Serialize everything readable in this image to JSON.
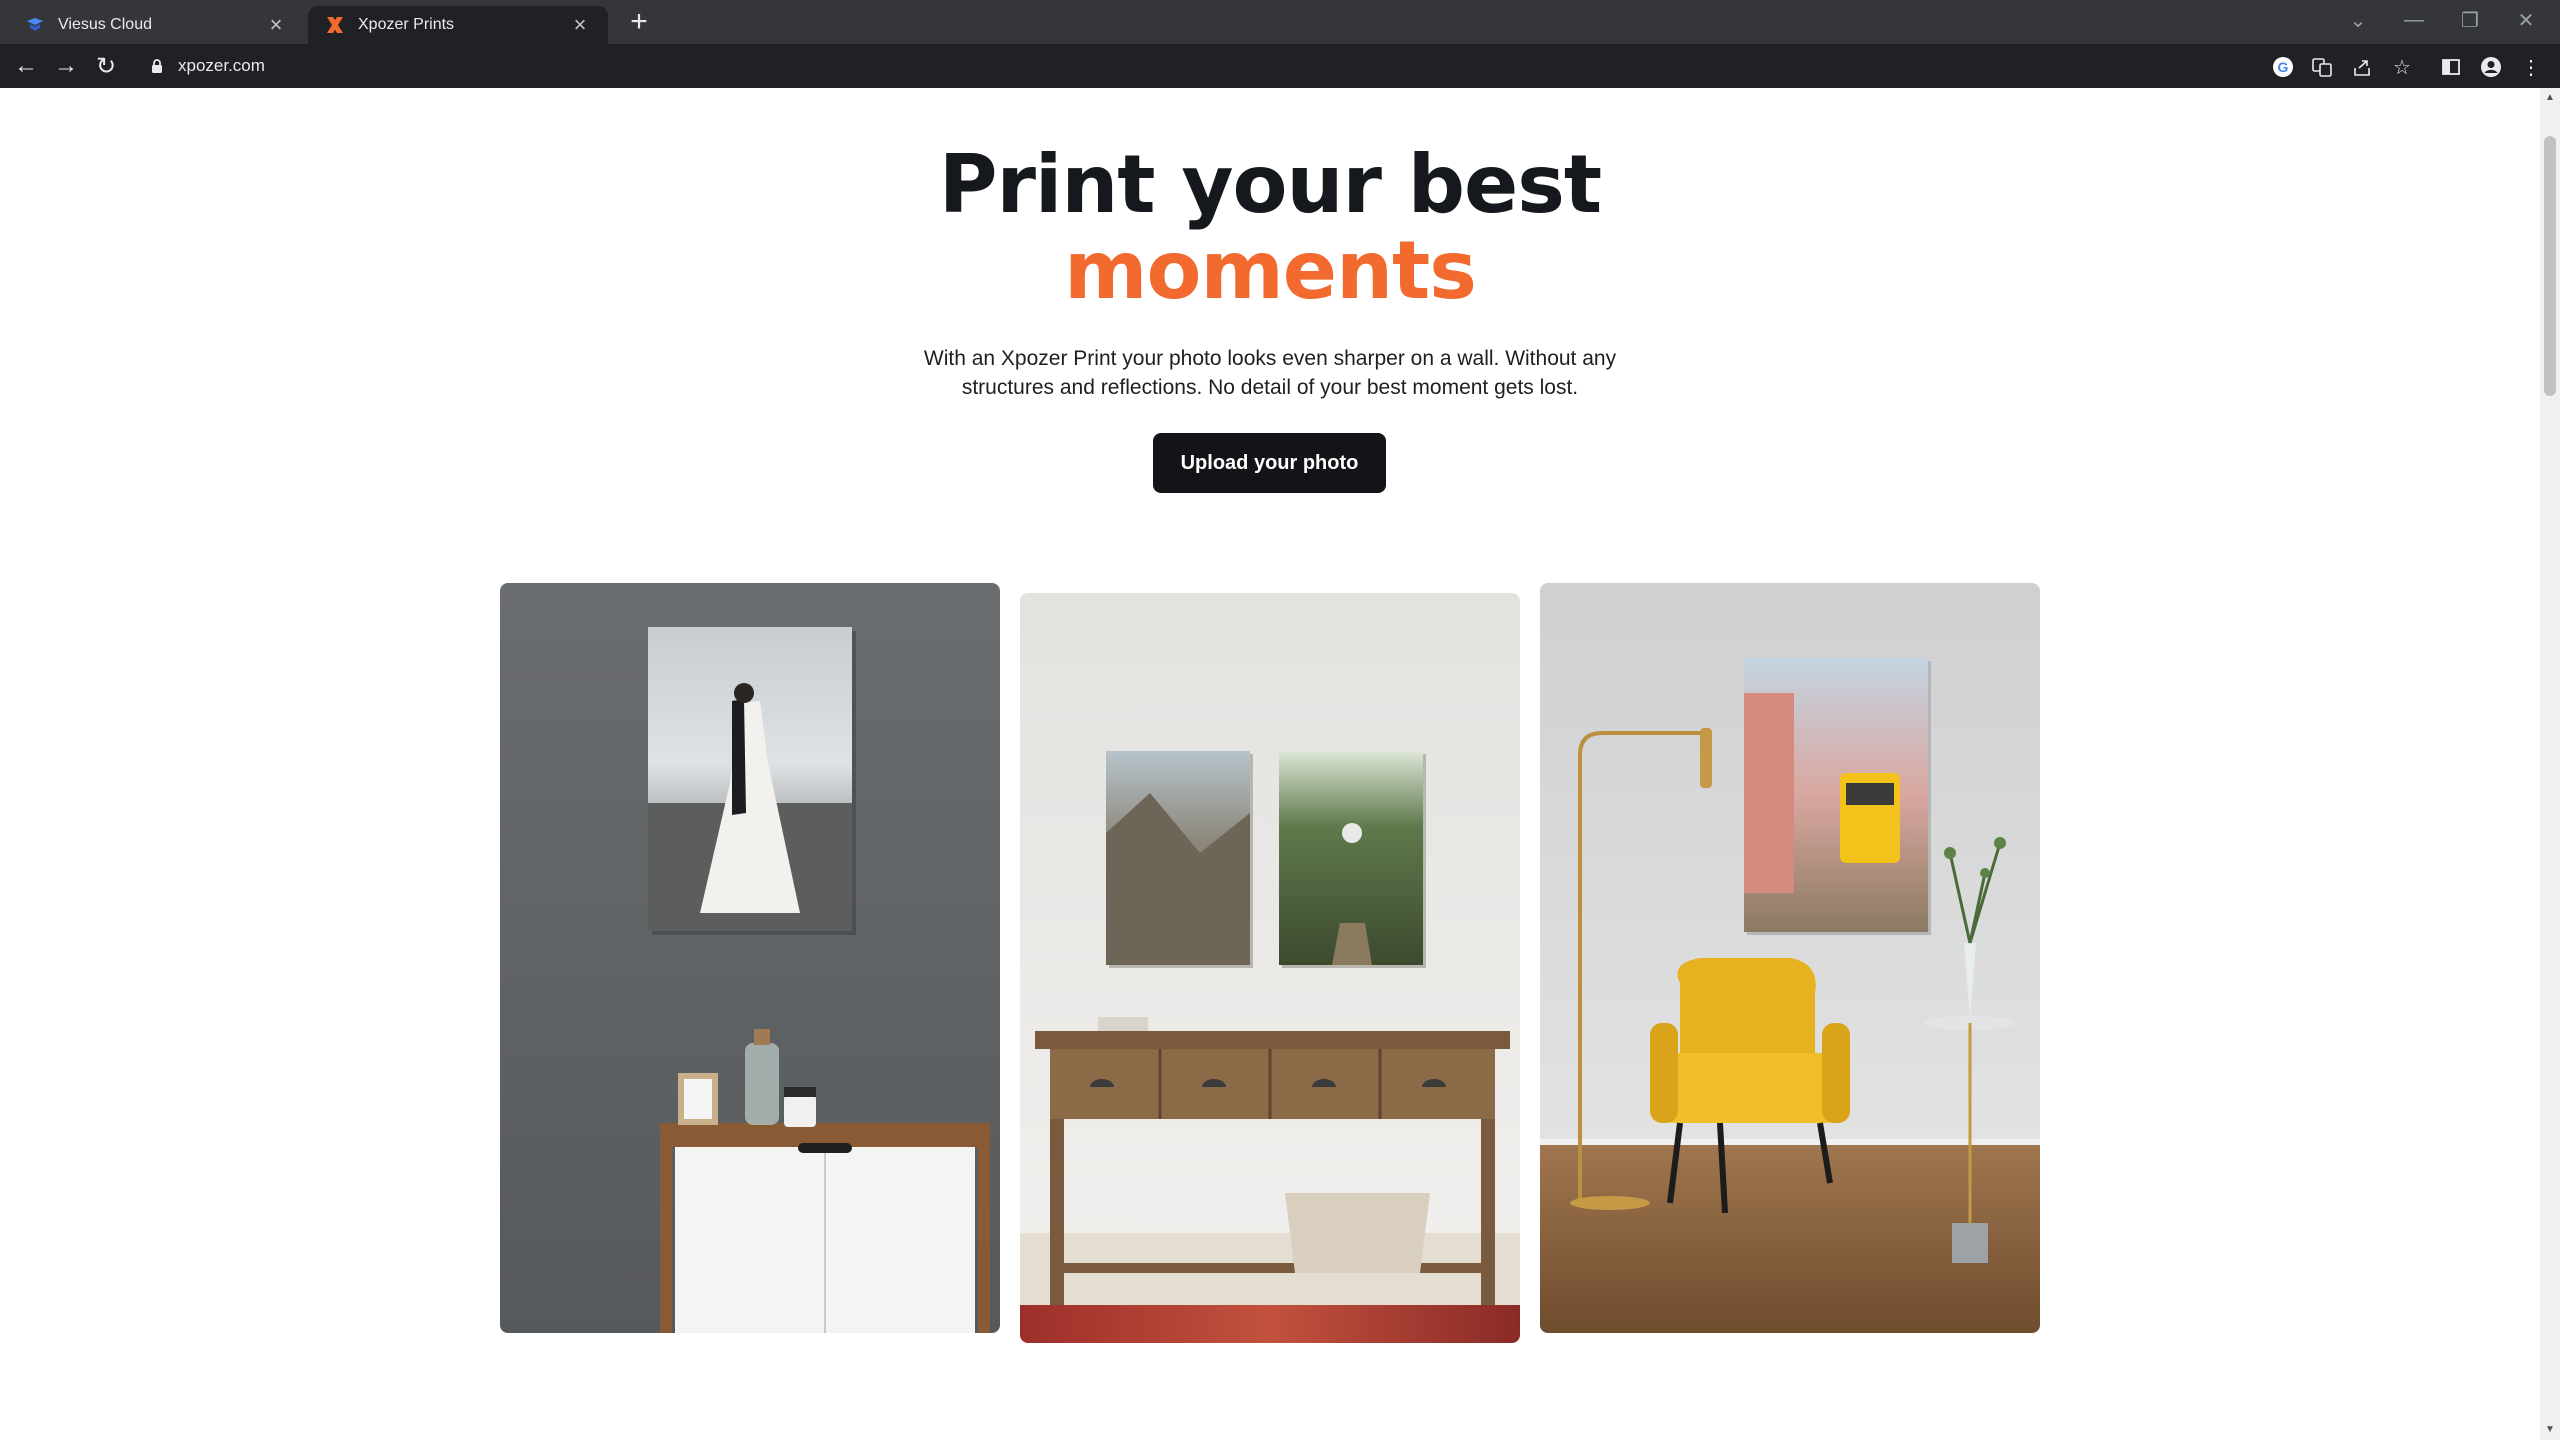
{
  "browser": {
    "tabs": [
      {
        "title": "Viesus Cloud",
        "active": false
      },
      {
        "title": "Xpozer Prints",
        "active": true
      }
    ],
    "new_tab": "+",
    "url": "xpozer.com"
  },
  "hero": {
    "headline_line1": "Print your best",
    "headline_line2": "moments",
    "description": "With an Xpozer Print your photo looks even sharper on a wall. Without any structures and reflections. No detail of your best moment gets lost.",
    "cta_label": "Upload your photo"
  },
  "gallery": {
    "images": [
      {
        "subject": "wedding photo print above white sideboard on grey wall"
      },
      {
        "subject": "two hiking photo prints above wooden console table"
      },
      {
        "subject": "tram street photo print above yellow armchair"
      }
    ]
  },
  "colors": {
    "accent": "#f26a2e",
    "headline": "#15181d",
    "button": "#121417"
  }
}
